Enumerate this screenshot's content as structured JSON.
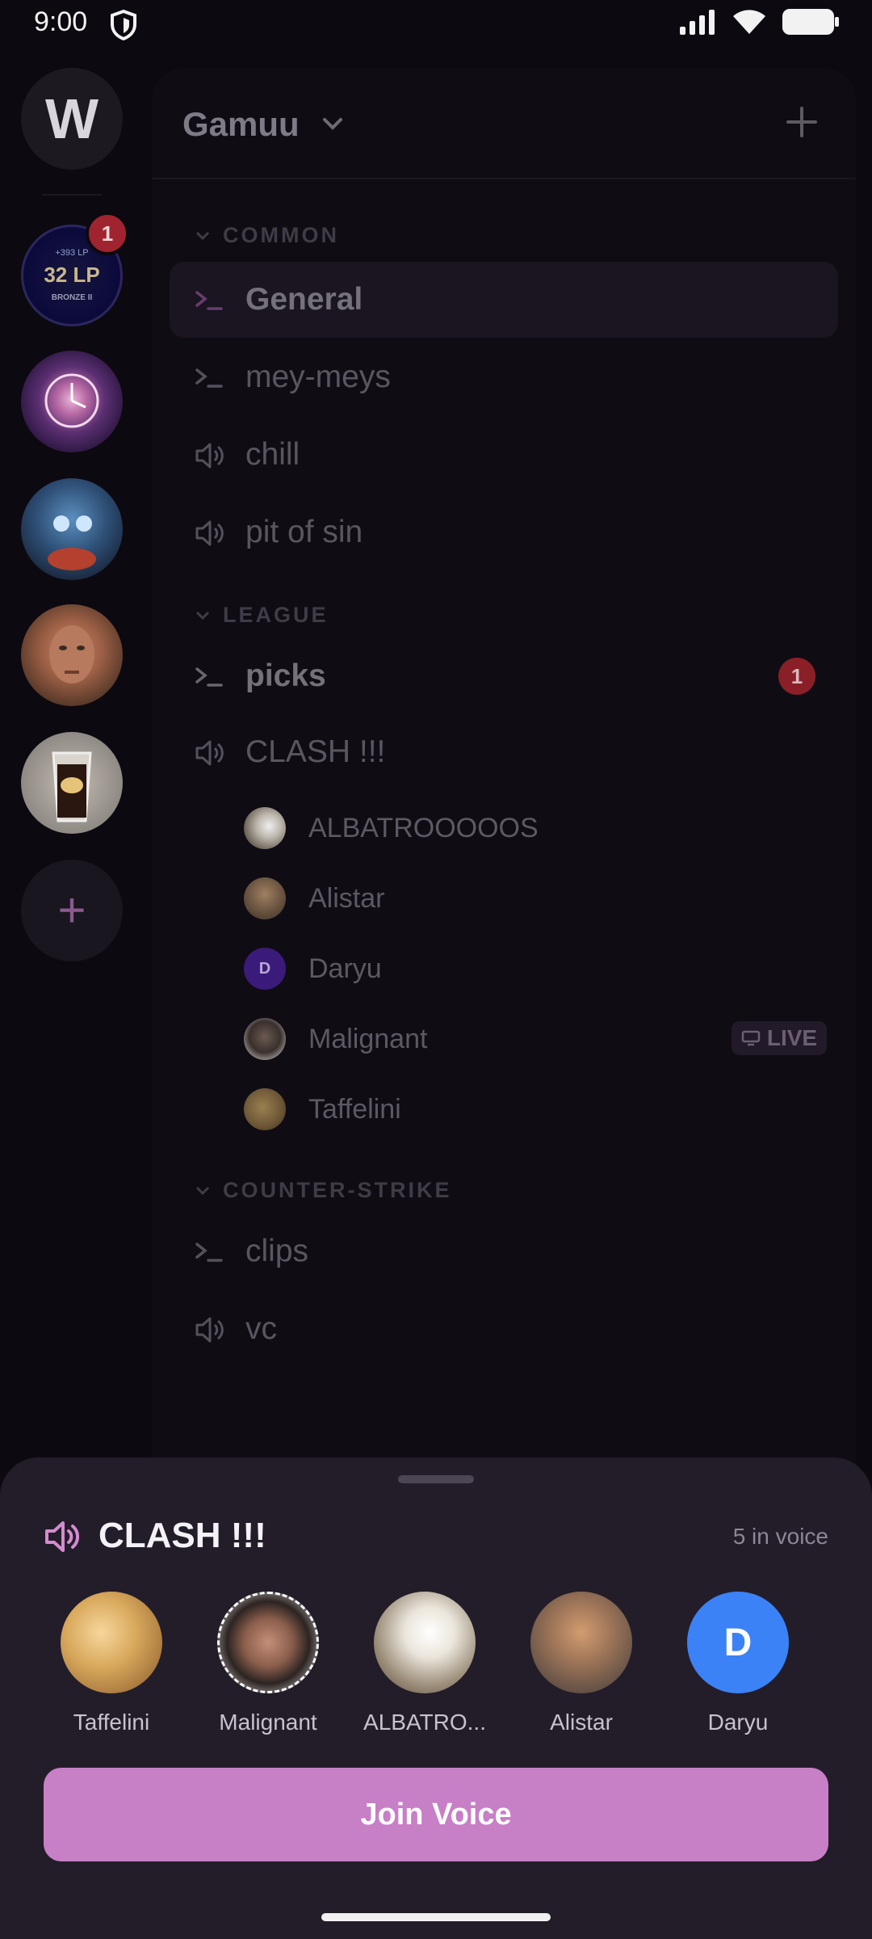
{
  "status_bar": {
    "time": "9:00"
  },
  "server_rail": {
    "logo_letter": "W",
    "first_server": {
      "line1": "+393 LP",
      "line2": "32 LP",
      "line3": "BRONZE II",
      "badge": "1"
    },
    "add_label": "+"
  },
  "panel": {
    "server_name": "Gamuu",
    "categories": [
      {
        "label": "COMMON"
      },
      {
        "label": "LEAGUE"
      },
      {
        "label": "COUNTER-STRIKE"
      }
    ],
    "channels": {
      "general": "General",
      "mey_meys": "mey-meys",
      "chill": "chill",
      "pit_of_sin": "pit of sin",
      "picks": "picks",
      "picks_badge": "1",
      "clash": "CLASH !!!",
      "clips": "clips",
      "vc": "vc"
    },
    "voice_users": [
      {
        "name": "ALBATROOOOOS"
      },
      {
        "name": "Alistar"
      },
      {
        "name": "Daryu",
        "initial": "D"
      },
      {
        "name": "Malignant",
        "live": "LIVE"
      },
      {
        "name": "Taffelini"
      }
    ]
  },
  "sheet": {
    "title": "CLASH !!!",
    "count": "5 in voice",
    "members": [
      {
        "name": "Taffelini"
      },
      {
        "name": "Malignant"
      },
      {
        "name": "ALBATRO..."
      },
      {
        "name": "Alistar"
      },
      {
        "name": "Daryu",
        "initial": "D"
      }
    ],
    "join_label": "Join Voice"
  },
  "colors": {
    "accent": "#c77fc6",
    "badge": "#a0242f",
    "daryu_blue": "#3b82f6",
    "daryu_purple": "#3b1b7a"
  }
}
